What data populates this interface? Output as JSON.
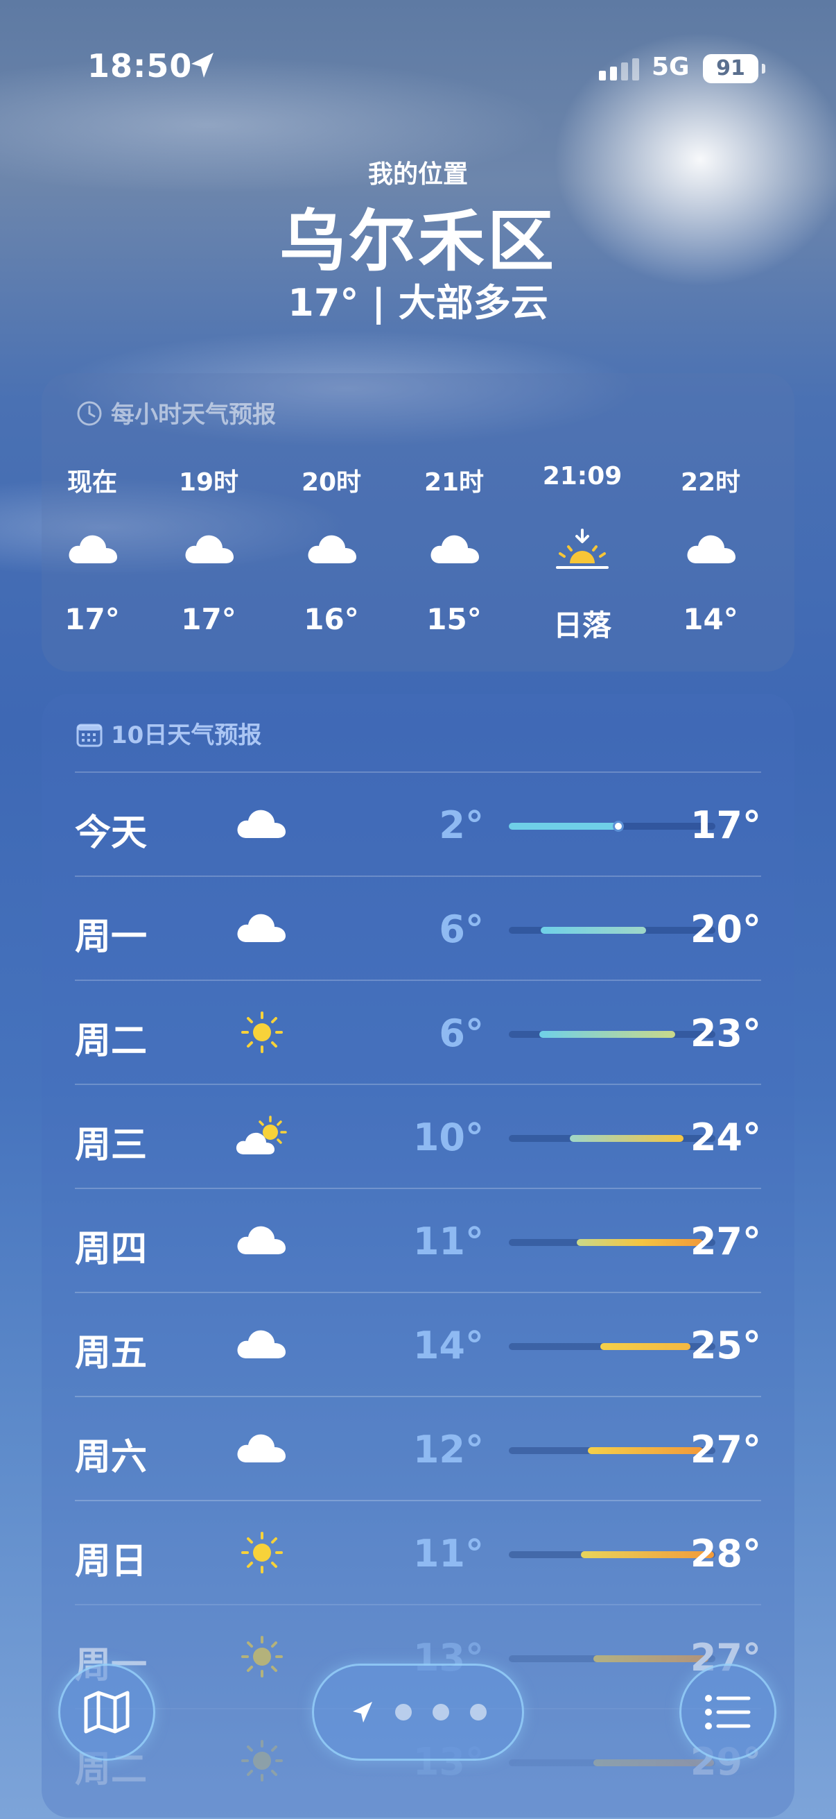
{
  "status_bar": {
    "time": "18:50",
    "network": "5G",
    "battery": "91"
  },
  "header": {
    "subtitle": "我的位置",
    "location": "乌尔禾区",
    "current": "17° | 大部多云"
  },
  "hourly": {
    "title": "每小时天气预报",
    "items": [
      {
        "label": "现在",
        "icon": "cloud-icon",
        "temp": "17°"
      },
      {
        "label": "19时",
        "icon": "cloud-icon",
        "temp": "17°"
      },
      {
        "label": "20时",
        "icon": "cloud-icon",
        "temp": "16°"
      },
      {
        "label": "21时",
        "icon": "cloud-icon",
        "temp": "15°"
      },
      {
        "label": "21:09",
        "icon": "sunset-icon",
        "temp": "日落"
      },
      {
        "label": "22时",
        "icon": "cloud-icon",
        "temp": "14°"
      }
    ]
  },
  "daily": {
    "title": "10日天气预报",
    "days": [
      {
        "label": "今天",
        "icon": "cloud-icon",
        "low": "2°",
        "high": "17°"
      },
      {
        "label": "周一",
        "icon": "cloud-icon",
        "low": "6°",
        "high": "20°"
      },
      {
        "label": "周二",
        "icon": "sun-icon",
        "low": "6°",
        "high": "23°"
      },
      {
        "label": "周三",
        "icon": "partly-cloudy-icon",
        "low": "10°",
        "high": "24°"
      },
      {
        "label": "周四",
        "icon": "cloud-icon",
        "low": "11°",
        "high": "27°"
      },
      {
        "label": "周五",
        "icon": "cloud-icon",
        "low": "14°",
        "high": "25°"
      },
      {
        "label": "周六",
        "icon": "cloud-icon",
        "low": "12°",
        "high": "27°"
      },
      {
        "label": "周日",
        "icon": "sun-icon",
        "low": "11°",
        "high": "28°"
      },
      {
        "label": "周一",
        "icon": "sun-icon",
        "low": "13°",
        "high": "27°"
      },
      {
        "label": "周二",
        "icon": "sun-icon",
        "low": "13°",
        "high": "29°"
      }
    ]
  },
  "colors": {
    "low_temp": "#8fbaf2",
    "bar_cool": "#6fd0e8",
    "bar_warm": "#f4c542",
    "bar_hot": "#f29a3a"
  }
}
